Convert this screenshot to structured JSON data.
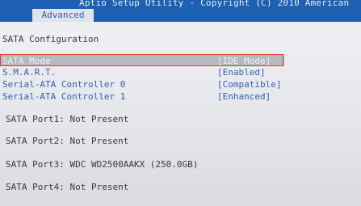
{
  "header": {
    "title": "Aptio Setup Utility - Copyright (C) 2010 American",
    "active_tab": "Advanced"
  },
  "page": {
    "section_title": "SATA Configuration"
  },
  "settings": [
    {
      "label": "SATA Mode",
      "value": "[IDE Mode]"
    },
    {
      "label": "S.M.A.R.T.",
      "value": "[Enabled]"
    },
    {
      "label": "Serial-ATA Controller 0",
      "value": "[Compatible]"
    },
    {
      "label": "Serial-ATA Controller 1",
      "value": "[Enhanced]"
    }
  ],
  "ports": [
    "SATA Port1: Not Present",
    "SATA Port2: Not Present",
    "SATA Port3: WDC WD2500AAKX (250.0GB)",
    "SATA Port4: Not Present"
  ],
  "colors": {
    "header_bg": "#1d5fb0",
    "option_text": "#2f5fb8",
    "highlight_outline": "#e23a3a"
  }
}
